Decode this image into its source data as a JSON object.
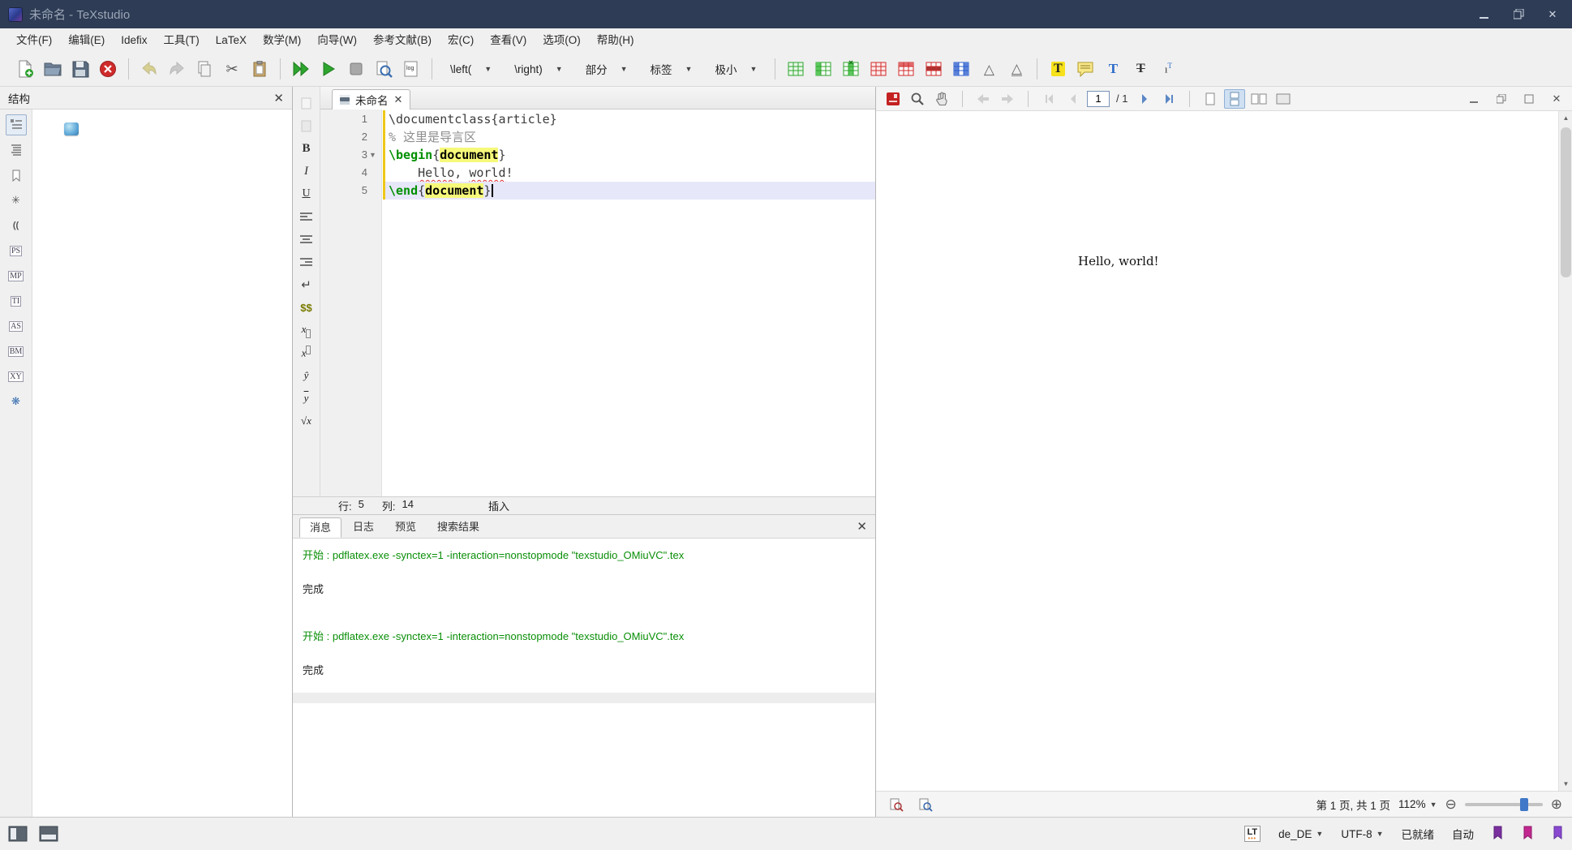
{
  "window": {
    "title": "未命名 - TeXstudio"
  },
  "menubar": {
    "items": [
      "文件(F)",
      "编辑(E)",
      "Idefix",
      "工具(T)",
      "LaTeX",
      "数学(M)",
      "向导(W)",
      "参考文献(B)",
      "宏(C)",
      "查看(V)",
      "选项(O)",
      "帮助(H)"
    ]
  },
  "toolbar": {
    "left_dd": "\\left(",
    "right_dd": "\\right)",
    "section_dd": "部分",
    "tag_dd": "标签",
    "size_dd": "极小",
    "log_badge": "log"
  },
  "structure": {
    "title": "结构"
  },
  "sidebar_badges": [
    "PS",
    "MP",
    "TI",
    "AS",
    "BM",
    "XY"
  ],
  "editor": {
    "tab_title": "未命名",
    "gutter": [
      "1",
      "2",
      "3",
      "4",
      "5"
    ],
    "code": {
      "line1": "\\documentclass{article}",
      "line2": "% 这里是导言区",
      "line3_cmd": "\\begin",
      "line3_brace_open": "{",
      "line3_env": "document",
      "line3_brace_close": "}",
      "line4_indent": "    ",
      "line4_word1": "Hello",
      "line4_mid": ", ",
      "line4_word2": "world",
      "line4_bang": "!",
      "line5_cmd": "\\end",
      "line5_brace_open": "{",
      "line5_env": "document",
      "line5_brace_close": "}"
    },
    "statusline": {
      "row_label": "行:",
      "row_value": "5",
      "col_label": "列:",
      "col_value": "14",
      "mode": "插入"
    }
  },
  "messages": {
    "tabs": [
      "消息",
      "日志",
      "预览",
      "搜索结果"
    ],
    "log_start1": "开始 : pdflatex.exe -synctex=1 -interaction=nonstopmode \"texstudio_OMiuVC\".tex",
    "log_done1": "完成",
    "log_start2": "开始 : pdflatex.exe -synctex=1 -interaction=nonstopmode \"texstudio_OMiuVC\".tex",
    "log_done2": "完成"
  },
  "pdf": {
    "page_input": "1",
    "page_total": "/ 1",
    "document_text": "Hello, world!",
    "page_status": "第 1 页, 共 1 页",
    "zoom": "112%"
  },
  "statusbar": {
    "languagetool": "LT",
    "dictionary": "de_DE",
    "encoding": "UTF-8",
    "status": "已就绪",
    "auto": "自动"
  }
}
